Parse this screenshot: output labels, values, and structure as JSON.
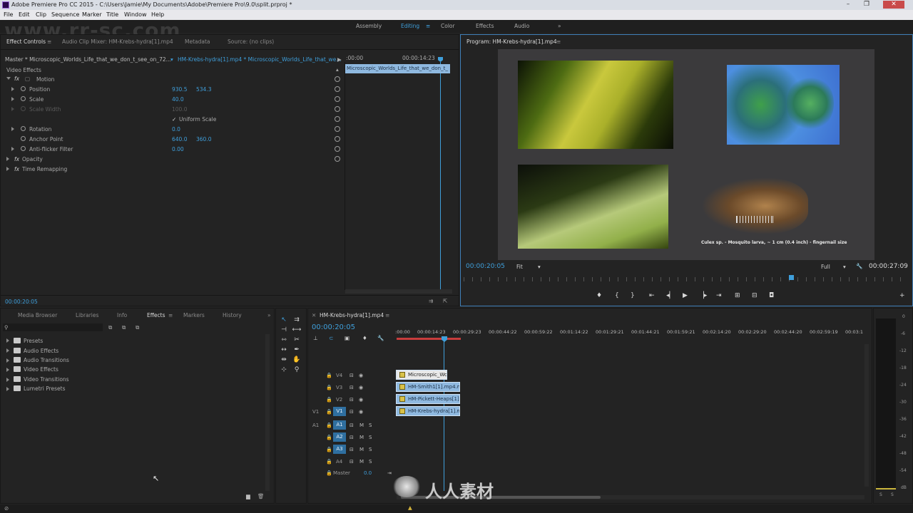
{
  "window": {
    "title": "Adobe Premiere Pro CC 2015 - C:\\Users\\Jamie\\My Documents\\Adobe\\Premiere Pro\\9.0\\split.prproj *"
  },
  "menu": [
    "File",
    "Edit",
    "Clip",
    "Sequence",
    "Marker",
    "Title",
    "Window",
    "Help"
  ],
  "workspaces": {
    "items": [
      "Assembly",
      "Editing",
      "Color",
      "Effects",
      "Audio"
    ],
    "active": "Editing",
    "more": "»"
  },
  "effect_controls": {
    "tabs": [
      "Effect Controls",
      "Audio Clip Mixer: HM-Krebs-hydra[1].mp4",
      "Metadata",
      "Source: (no clips)"
    ],
    "master_label": "Master * Microscopic_Worlds_Life_that_we_don_t_see_on_72...",
    "clip_label": "HM-Krebs-hydra[1].mp4 * Microscopic_Worlds_Life_that_we...",
    "time_start": ":00:00",
    "time_end": "00:00:14:23",
    "clip_bar": "Microscopic_Worlds_Life_that_we_don_t_",
    "section": "Video Effects",
    "motion": "Motion",
    "position_label": "Position",
    "position_x": "930.5",
    "position_y": "534.3",
    "scale_label": "Scale",
    "scale_value": "40.0",
    "scale_width_label": "Scale Width",
    "scale_width_value": "100.0",
    "uniform_scale": "Uniform Scale",
    "rotation_label": "Rotation",
    "rotation_value": "0.0",
    "anchor_label": "Anchor Point",
    "anchor_x": "640.0",
    "anchor_y": "360.0",
    "antiflicker_label": "Anti-flicker Filter",
    "antiflicker_value": "0.00",
    "opacity": "Opacity",
    "time_remap": "Time Remapping",
    "timecode": "00:00:20:05"
  },
  "program": {
    "title": "Program: HM-Krebs-hydra[1].mp4",
    "timecode": "00:00:20:05",
    "fit": "Fit",
    "quality": "Full",
    "duration": "00:00:27:09",
    "caption": "Culex sp. - Mosquito larva, ~ 1 cm (0.4 inch) - fingernail size"
  },
  "project": {
    "tabs": [
      "Media Browser",
      "Libraries",
      "Info",
      "Effects",
      "Markers",
      "History"
    ],
    "active_tab": "Effects",
    "items": [
      "Presets",
      "Audio Effects",
      "Audio Transitions",
      "Video Effects",
      "Video Transitions",
      "Lumetri Presets"
    ]
  },
  "timeline": {
    "tab": "HM-Krebs-hydra[1].mp4",
    "timecode": "00:00:20:05",
    "ruler": [
      ":00:00",
      "00:00:14:23",
      "00:00:29:23",
      "00:00:44:22",
      "00:00:59:22",
      "00:01:14:22",
      "00:01:29:21",
      "00:01:44:21",
      "00:01:59:21",
      "00:02:14:20",
      "00:02:29:20",
      "00:02:44:20",
      "00:02:59:19",
      "00:03:1"
    ],
    "video_tracks": [
      "V4",
      "V3",
      "V2",
      "V1"
    ],
    "audio_tracks": [
      "A1",
      "A2",
      "A3",
      "A4"
    ],
    "source_v": "V1",
    "source_a": "A1",
    "master": "Master",
    "master_value": "0.0",
    "clips": [
      "Microscopic_Wo",
      "HM-Smith1[1].mp4.mp",
      "HM-Pickett-Heaps[1]",
      "HM-Krebs-hydra[1].mp"
    ]
  },
  "meter": {
    "scale": [
      "0",
      "-6",
      "-12",
      "-18",
      "-24",
      "-30",
      "-36",
      "-42",
      "-48",
      "-54",
      "dB"
    ],
    "solo_labels": [
      "S",
      "S"
    ]
  },
  "watermarks": {
    "top": "www.rr-sc.com",
    "brand": "人人素材",
    "url": "www.rr-sc.com"
  },
  "colors": {
    "accent": "#3f9fdb",
    "clip": "#8fb9e0",
    "panel": "#232323"
  }
}
